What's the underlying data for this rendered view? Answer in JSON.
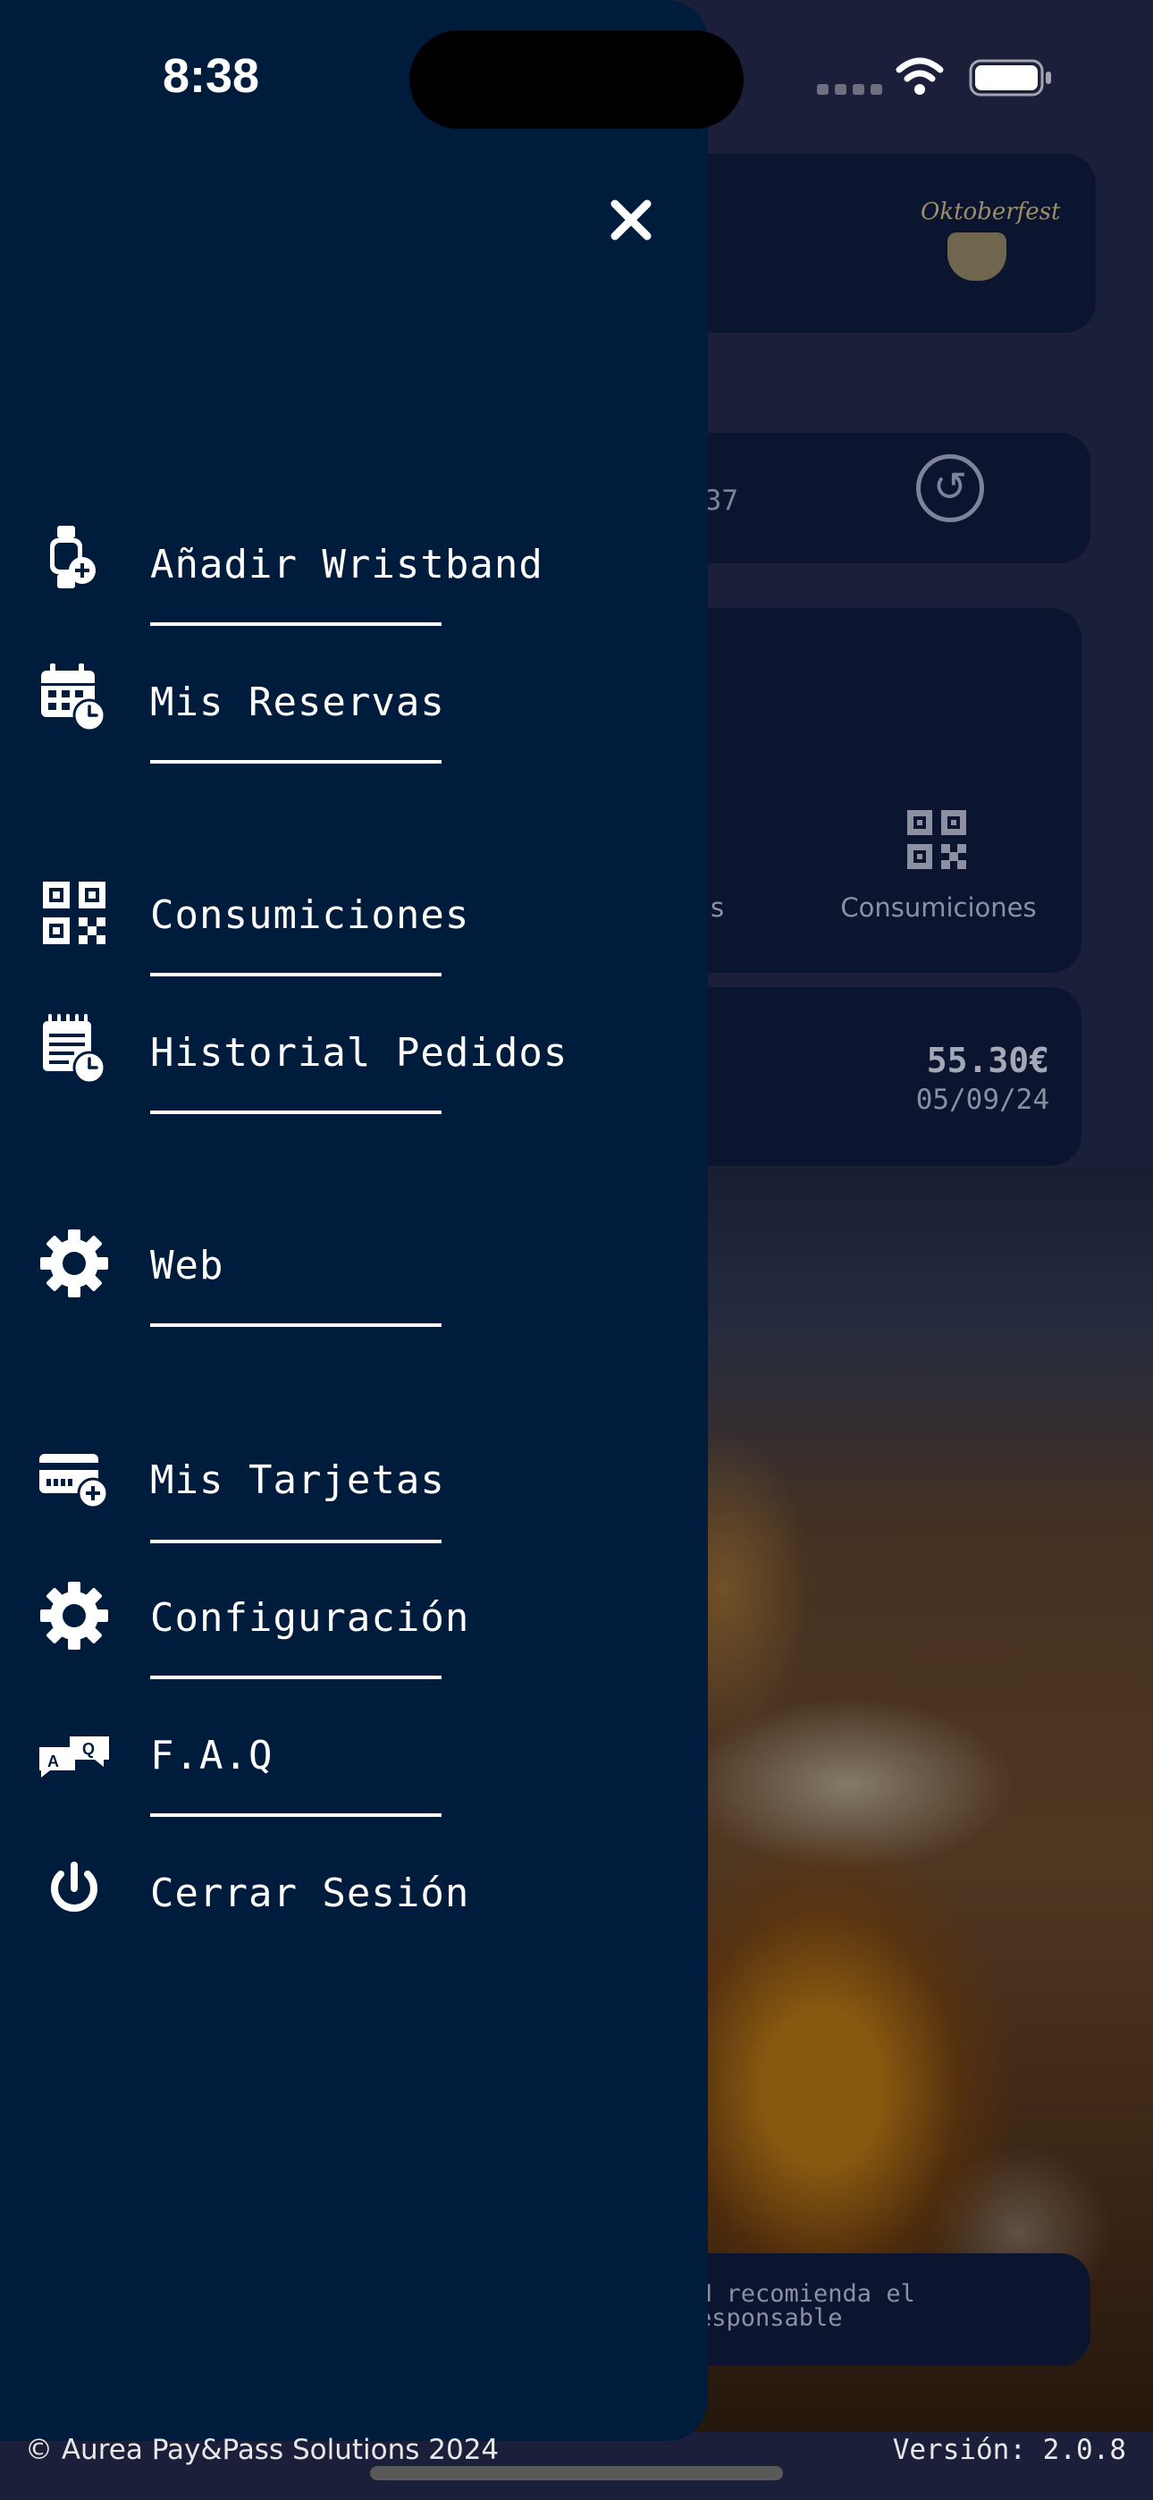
{
  "status_bar": {
    "time": "8:38"
  },
  "background": {
    "logo_text": "Oktoberfest",
    "timer_text": ":37",
    "actions": {
      "left_label_partial": "s",
      "right_label": "Consumiciones"
    },
    "last_order": {
      "amount": "55.30€",
      "date": "05/09/24"
    },
    "info_line1": "N recomienda el",
    "info_line2": "esponsable"
  },
  "drawer": {
    "menu": [
      {
        "label": "Añadir Wristband",
        "icon": "wristband-add-icon"
      },
      {
        "label": "Mis Reservas",
        "icon": "calendar-clock-icon"
      },
      {
        "label": "Consumiciones",
        "icon": "qr-code-icon"
      },
      {
        "label": "Historial Pedidos",
        "icon": "notepad-clock-icon"
      },
      {
        "label": "Web",
        "icon": "gear-icon"
      },
      {
        "label": "Mis Tarjetas",
        "icon": "card-add-icon"
      },
      {
        "label": "Configuración",
        "icon": "gear-icon"
      },
      {
        "label": "F.A.Q",
        "icon": "chat-bubbles-icon"
      },
      {
        "label": "Cerrar Sesión",
        "icon": "power-icon"
      }
    ]
  },
  "footer": {
    "copyright": "© Aurea Pay&Pass Solutions 2024",
    "version": "Versión: 2.0.8"
  }
}
